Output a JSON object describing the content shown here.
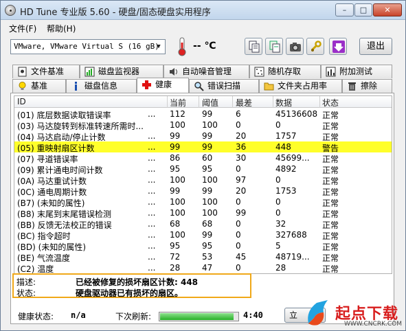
{
  "window": {
    "title": "HD Tune 专业版 5.60 - 硬盘/固态硬盘实用程序"
  },
  "caption_buttons": {
    "minimize": "–",
    "maximize": "□",
    "close": "✕"
  },
  "menu": {
    "file": "文件(F)",
    "help": "帮助(H)"
  },
  "toolbar": {
    "drive": "VMware, VMware Virtual S (16 gB)",
    "temperature": "-- ℃",
    "exit_label": "退出"
  },
  "tabs_top": [
    {
      "label": "文件基准",
      "icon": "file-benchmark-icon"
    },
    {
      "label": "磁盘监视器",
      "icon": "disk-monitor-icon"
    },
    {
      "label": "自动噪音管理",
      "icon": "speaker-icon"
    },
    {
      "label": "随机存取",
      "icon": "random-access-icon"
    },
    {
      "label": "附加测试",
      "icon": "extra-tests-icon"
    }
  ],
  "tabs_bottom": [
    {
      "label": "基准",
      "icon": "lightbulb-icon"
    },
    {
      "label": "磁盘信息",
      "icon": "info-icon"
    },
    {
      "label": "健康",
      "icon": "health-cross-icon",
      "active": true
    },
    {
      "label": "错误扫描",
      "icon": "magnifier-icon"
    },
    {
      "label": "文件夹占用率",
      "icon": "folder-icon"
    },
    {
      "label": "擦除",
      "icon": "trash-icon"
    }
  ],
  "table": {
    "headers": {
      "id": "ID",
      "current": "当前",
      "threshold": "阈值",
      "worst": "最差",
      "data": "数据",
      "status": "状态"
    },
    "rows": [
      {
        "id": "(01) 底层数据读取错误率",
        "dots": "...",
        "current": "112",
        "threshold": "99",
        "worst": "6",
        "data": "45136608",
        "status": "正常"
      },
      {
        "id": "(03) 马达旋转到标准转速所需时...",
        "dots": "",
        "current": "100",
        "threshold": "100",
        "worst": "0",
        "data": "0",
        "status": "正常"
      },
      {
        "id": "(04) 马达启动/停止计数",
        "dots": "...",
        "current": "99",
        "threshold": "99",
        "worst": "20",
        "data": "1757",
        "status": "正常"
      },
      {
        "id": "(05) 重映射扇区计数",
        "dots": "...",
        "current": "99",
        "threshold": "99",
        "worst": "36",
        "data": "448",
        "status": "警告",
        "highlight": true
      },
      {
        "id": "(07) 寻道错误率",
        "dots": "...",
        "current": "86",
        "threshold": "60",
        "worst": "30",
        "data": "45699...",
        "status": "正常"
      },
      {
        "id": "(09) 累计通电时间计数",
        "dots": "...",
        "current": "95",
        "threshold": "95",
        "worst": "0",
        "data": "4892",
        "status": "正常"
      },
      {
        "id": "(0A) 马达重试计数",
        "dots": "...",
        "current": "100",
        "threshold": "100",
        "worst": "97",
        "data": "0",
        "status": "正常"
      },
      {
        "id": "(0C) 通电周期计数",
        "dots": "...",
        "current": "99",
        "threshold": "99",
        "worst": "20",
        "data": "1753",
        "status": "正常"
      },
      {
        "id": "(B7) (未知的属性)",
        "dots": "...",
        "current": "100",
        "threshold": "100",
        "worst": "0",
        "data": "0",
        "status": "正常"
      },
      {
        "id": "(B8) 末尾到末尾错误检测",
        "dots": "...",
        "current": "100",
        "threshold": "100",
        "worst": "99",
        "data": "0",
        "status": "正常"
      },
      {
        "id": "(BB) 反馈无法校正的错误",
        "dots": "...",
        "current": "68",
        "threshold": "68",
        "worst": "0",
        "data": "32",
        "status": "正常"
      },
      {
        "id": "(BC) 指令超时",
        "dots": "...",
        "current": "100",
        "threshold": "99",
        "worst": "0",
        "data": "327688",
        "status": "正常"
      },
      {
        "id": "(BD) (未知的属性)",
        "dots": "...",
        "current": "95",
        "threshold": "95",
        "worst": "0",
        "data": "5",
        "status": "正常"
      },
      {
        "id": "(BE) 气流温度",
        "dots": "...",
        "current": "72",
        "threshold": "53",
        "worst": "45",
        "data": "48719...",
        "status": "正常"
      },
      {
        "id": "(C2) 温度",
        "dots": "...",
        "current": "28",
        "threshold": "47",
        "worst": "0",
        "data": "28",
        "status": "正常"
      }
    ]
  },
  "description": {
    "label1": "描述:",
    "value1": "已经被修复的损坏扇区计数: 448",
    "label2": "状态:",
    "value2": "硬盘驱动器已有损坏的扇区。"
  },
  "status_bar": {
    "health_label": "健康状态:",
    "health_value": "n/a",
    "refresh_label": "下次刷新:",
    "refresh_progress": 0.95,
    "refresh_time": "4:40",
    "refresh_button": "立"
  },
  "watermark": {
    "text": "起点下载",
    "sub": "WWW.CNCRK.COM"
  }
}
